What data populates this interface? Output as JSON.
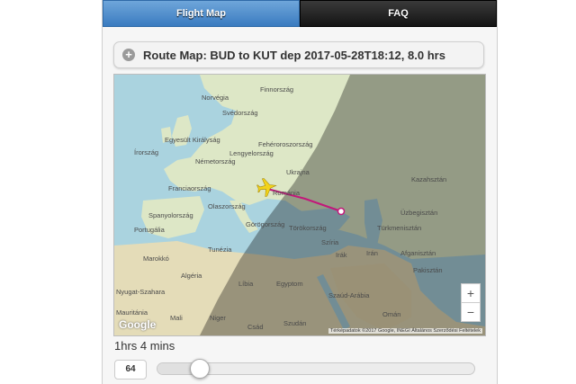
{
  "tabs": [
    {
      "label": "Flight Map",
      "active": true
    },
    {
      "label": "FAQ",
      "active": false
    }
  ],
  "header": {
    "title": "Route Map: BUD to KUT dep 2017-05-28T18:12, 8.0 hrs",
    "icon": "plus-circle-icon"
  },
  "map": {
    "labels": {
      "finland": "Finnország",
      "norway": "Norvégia",
      "sweden": "Svédország",
      "uk": "Egyesült Királyság",
      "ireland": "Írország",
      "belarus": "Fehéroroszország",
      "poland": "Lengyelország",
      "germany": "Németország",
      "ukraine": "Ukrajna",
      "france": "Franciaország",
      "romania": "Románia",
      "kazakhstan": "Kazahsztán",
      "italy": "Olaszország",
      "uzbekistan": "Üzbegisztán",
      "spain": "Spanyolország",
      "greece": "Görögország",
      "turkey": "Törökország",
      "turkmenistan": "Türkmenisztán",
      "portugal": "Portugália",
      "tunisia": "Tunézia",
      "syria": "Szíria",
      "iraq": "Irák",
      "iran": "Irán",
      "afghanistan": "Afganisztán",
      "morocco": "Marokkó",
      "pakistan": "Pakisztán",
      "algeria": "Algéria",
      "libya": "Líbia",
      "egypt": "Egyptom",
      "western_sahara": "Nyugat-Szahara",
      "saudi": "Szaúd-Arábia",
      "mauritania": "Mauritánia",
      "mali": "Mali",
      "niger": "Niger",
      "chad": "Csád",
      "sudan": "Szudán",
      "oman": "Omán"
    },
    "zoom_in": "+",
    "zoom_out": "−",
    "google": "Google",
    "credit": "Térképadatok ©2017 Google, INEGI   Általános Szerződési Feltételek",
    "plane_icon": "airplane-icon",
    "destination_icon": "destination-marker-icon"
  },
  "slider": {
    "duration_label": "1hrs 4 mins",
    "value": "64",
    "min": 0,
    "max": 480,
    "current": 64
  }
}
